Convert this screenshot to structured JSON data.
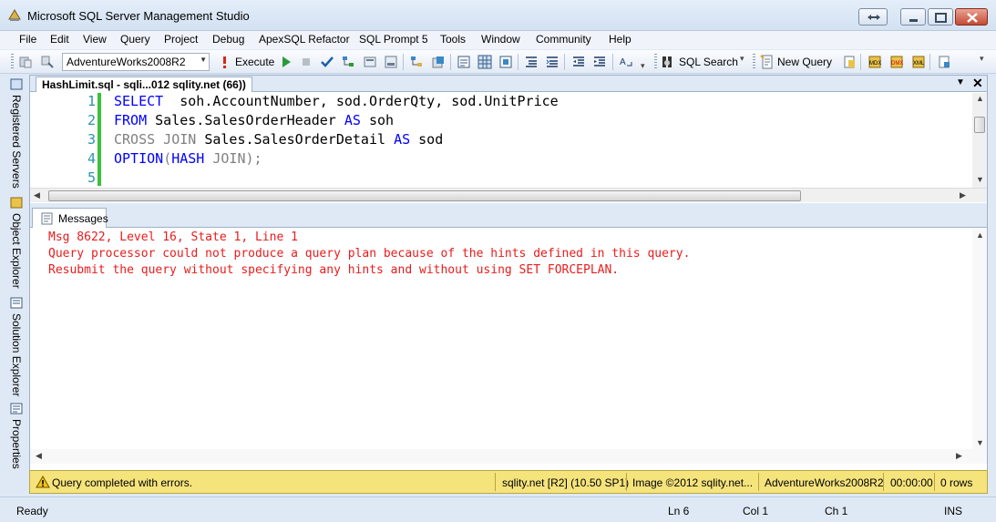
{
  "window": {
    "title": "Microsoft SQL Server Management Studio"
  },
  "menu": [
    "File",
    "Edit",
    "View",
    "Query",
    "Project",
    "Debug",
    "ApexSQL Refactor",
    "SQL Prompt 5",
    "Tools",
    "Window",
    "Community",
    "Help"
  ],
  "toolbar": {
    "database": "AdventureWorks2008R2",
    "execute_label": "Execute",
    "sql_search_label": "SQL Search",
    "new_query_label": "New Query"
  },
  "sidebar": {
    "tabs": [
      "Registered Servers",
      "Object Explorer",
      "Solution Explorer",
      "Properties"
    ]
  },
  "document": {
    "tab_title": "HashLimit.sql - sqli...012 sqlity.net (66))",
    "line_numbers": [
      "1",
      "2",
      "3",
      "4",
      "5"
    ],
    "code": {
      "l1_kw": "SELECT",
      "l1_rest": "  soh.AccountNumber, sod.OrderQty, sod.UnitPrice",
      "l2_kw": "FROM",
      "l2_mid": " Sales.SalesOrderHeader ",
      "l2_kw2": "AS",
      "l2_rest": " soh",
      "l3_gray": "CROSS JOIN",
      "l3_mid": " Sales.SalesOrderDetail ",
      "l3_kw": "AS",
      "l3_rest": " sod",
      "l4_kw": "OPTION",
      "l4_g1": "(",
      "l4_kw2": "HASH",
      "l4_g2": " JOIN);"
    }
  },
  "results": {
    "tab_label": "Messages",
    "lines": [
      "Msg 8622, Level 16, State 1, Line 1",
      "Query processor could not produce a query plan because of the hints defined in this query.",
      "Resubmit the query without specifying any hints and without using SET FORCEPLAN."
    ]
  },
  "query_status": {
    "message": "Query completed with errors.",
    "server": "sqlity.net [R2] (10.50 SP1)",
    "user": "Image ©2012 sqlity.net...",
    "database": "AdventureWorks2008R2",
    "elapsed": "00:00:00",
    "rows": "0 rows"
  },
  "statusbar": {
    "state": "Ready",
    "line": "Ln 6",
    "col": "Col 1",
    "ch": "Ch 1",
    "mode": "INS"
  },
  "colors": {
    "keyword": "#0000ff",
    "error_text": "#e81c1c",
    "status_yellow": "#f5e37c",
    "line_number": "#2b91af"
  }
}
